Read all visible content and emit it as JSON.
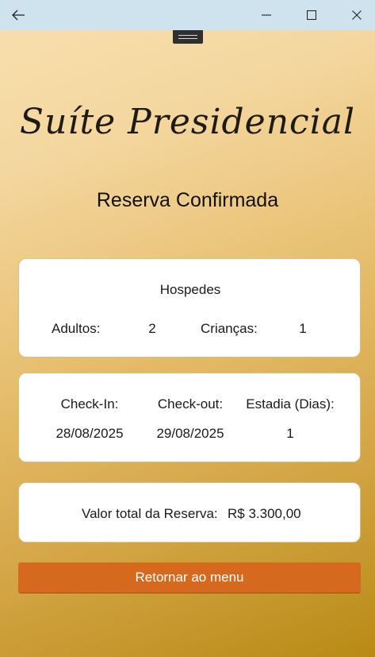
{
  "window": {
    "back_icon": "arrow-left-icon",
    "minimize_icon": "minimize-icon",
    "maximize_icon": "maximize-icon",
    "close_icon": "close-icon"
  },
  "header": {
    "brand": "Suíte Presidencial",
    "subtitle": "Reserva Confirmada"
  },
  "guests": {
    "title": "Hospedes",
    "adults_label": "Adultos:",
    "adults_value": "2",
    "children_label": "Crianças:",
    "children_value": "1"
  },
  "stay": {
    "checkin_label": "Check-In:",
    "checkin_value": "28/08/2025",
    "checkout_label": "Check-out:",
    "checkout_value": "29/08/2025",
    "days_label": "Estadia (Dias):",
    "days_value": "1"
  },
  "total": {
    "label": "Valor total da Reserva:",
    "value": "R$ 3.300,00"
  },
  "actions": {
    "return_label": "Retornar ao menu"
  },
  "colors": {
    "accent": "#d56a1f",
    "titlebar": "#cfe3ef"
  }
}
